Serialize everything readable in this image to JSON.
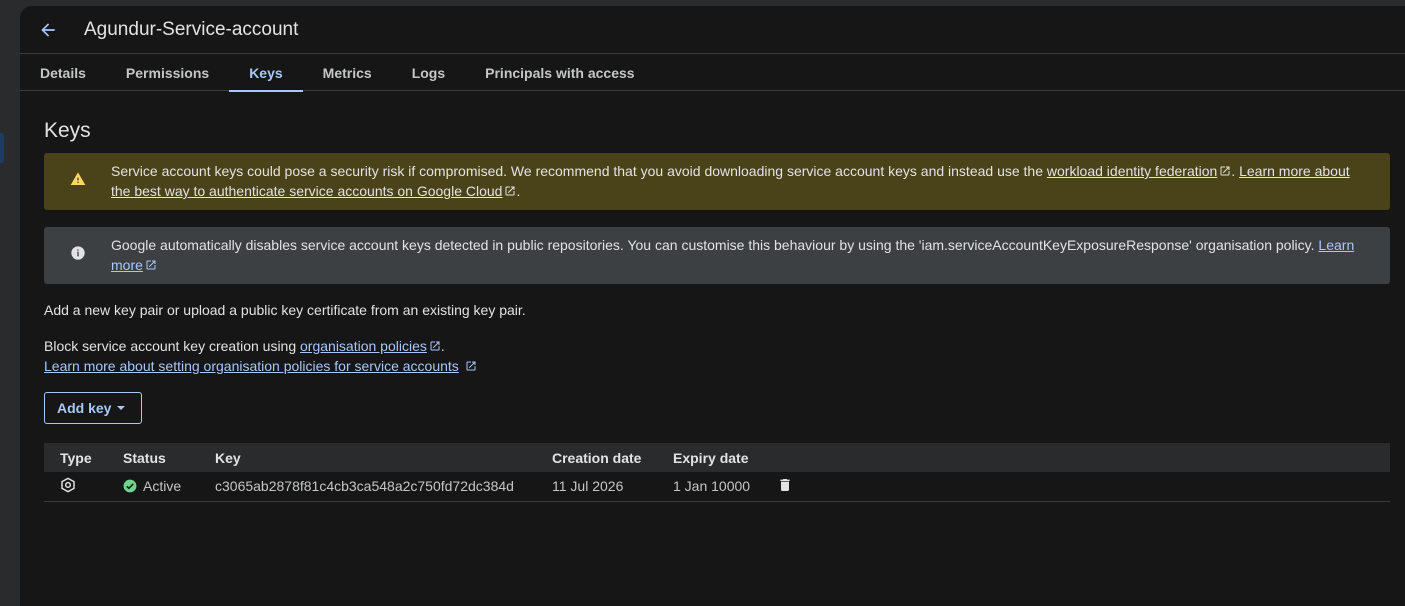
{
  "header": {
    "title": "Agundur-Service-account"
  },
  "tabs": [
    {
      "label": "Details"
    },
    {
      "label": "Permissions"
    },
    {
      "label": "Keys"
    },
    {
      "label": "Metrics"
    },
    {
      "label": "Logs"
    },
    {
      "label": "Principals with access"
    }
  ],
  "active_tab": "Keys",
  "section": {
    "title": "Keys"
  },
  "warning_banner": {
    "text_before": "Service account keys could pose a security risk if compromised. We recommend that you avoid downloading service account keys and instead use the ",
    "link1": "workload identity federation",
    "text_between": ". ",
    "link2": "Learn more about the best way to authenticate service accounts on Google Cloud",
    "text_after": "."
  },
  "info_banner": {
    "text": "Google automatically disables service account keys detected in public repositories. You can customise this behaviour by using the 'iam.serviceAccountKeyExposureResponse' organisation policy. ",
    "link": "Learn more"
  },
  "intro": {
    "text": "Add a new key pair or upload a public key certificate from an existing key pair."
  },
  "policy": {
    "text_before": "Block service account key creation using ",
    "link1": "organisation policies",
    "text_after": ".",
    "link2": "Learn more about setting organisation policies for service accounts"
  },
  "add_key_button": {
    "label": "Add key"
  },
  "table": {
    "columns": [
      "Type",
      "Status",
      "Key",
      "Creation date",
      "Expiry date"
    ],
    "rows": [
      {
        "type_icon": "managed-key-icon",
        "status": "Active",
        "key": "c3065ab2878f81c4cb3ca548a2c750fd72dc384d",
        "creation_date": "11 Jul 2026",
        "expiry_date": "1 Jan 10000"
      }
    ]
  },
  "colors": {
    "accent": "#a8c7fa",
    "warning_bg": "#4a4219",
    "info_bg": "#3c4043",
    "success": "#6dd58c"
  }
}
